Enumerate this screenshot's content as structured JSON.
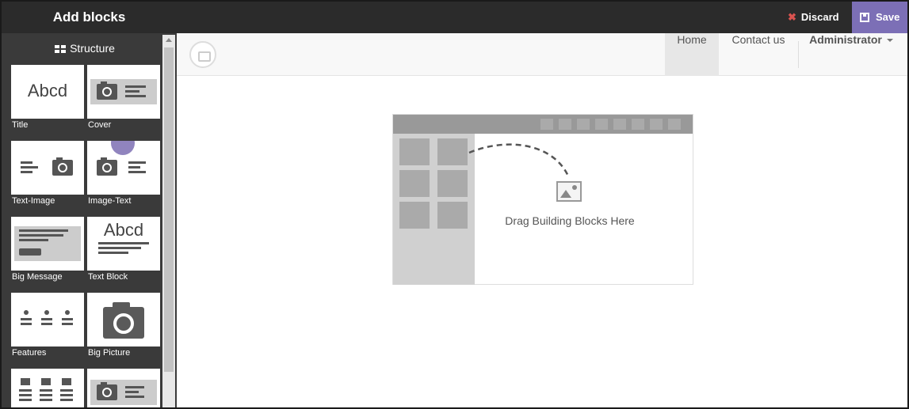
{
  "panel": {
    "title": "Add blocks",
    "section_label": "Structure",
    "blocks": [
      {
        "label": "Title",
        "thumb_text": "Abcd"
      },
      {
        "label": "Cover"
      },
      {
        "label": "Text-Image"
      },
      {
        "label": "Image-Text"
      },
      {
        "label": "Big Message"
      },
      {
        "label": "Text Block",
        "thumb_text": "Abcd"
      },
      {
        "label": "Features"
      },
      {
        "label": "Big Picture"
      }
    ]
  },
  "topbar": {
    "discard_label": "Discard",
    "save_label": "Save"
  },
  "navbar": {
    "items": [
      "Home",
      "Contact us"
    ],
    "user_menu": "Administrator"
  },
  "dropzone": {
    "text": "Drag Building Blocks Here"
  },
  "colors": {
    "save_accent": "#7c6fb6",
    "discard_icon": "#d9534f",
    "panel_bg": "#3a3a3a"
  }
}
